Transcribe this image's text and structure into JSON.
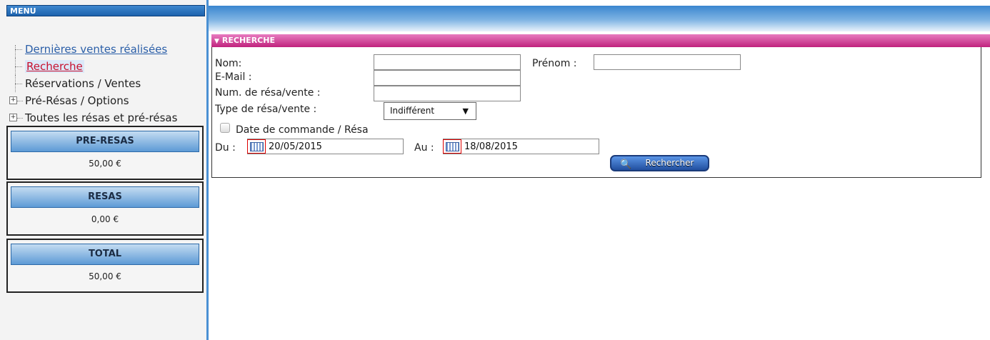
{
  "sidebar": {
    "menu_title": "MENU",
    "items": [
      {
        "label": "Dernières ventes réalisées"
      },
      {
        "label": "Recherche"
      },
      {
        "label": "Réservations / Ventes"
      },
      {
        "label": "Pré-Résas / Options"
      },
      {
        "label": "Toutes les résas et pré-résas"
      }
    ],
    "boxes": [
      {
        "title": "PRE-RESAS",
        "value": "50,00 €"
      },
      {
        "title": "RESAS",
        "value": "0,00 €"
      },
      {
        "title": "TOTAL",
        "value": "50,00 €"
      }
    ]
  },
  "search": {
    "header": "RECHERCHE",
    "nom_label": "Nom:",
    "prenom_label": "Prénom :",
    "email_label": "E-Mail :",
    "num_label": "Num. de résa/vente :",
    "type_label": "Type de résa/vente :",
    "type_value": "Indifférent",
    "date_check_label": "Date de commande / Résa",
    "du_label": "Du :",
    "du_value": "20/05/2015",
    "au_label": "Au :",
    "au_value": "18/08/2015",
    "button_label": "Rechercher"
  },
  "colors": {
    "menu_blue": "#1d62ad",
    "section_pink": "#c0237d",
    "link_blue": "#2b5fa8",
    "active_red": "#c8102e"
  }
}
